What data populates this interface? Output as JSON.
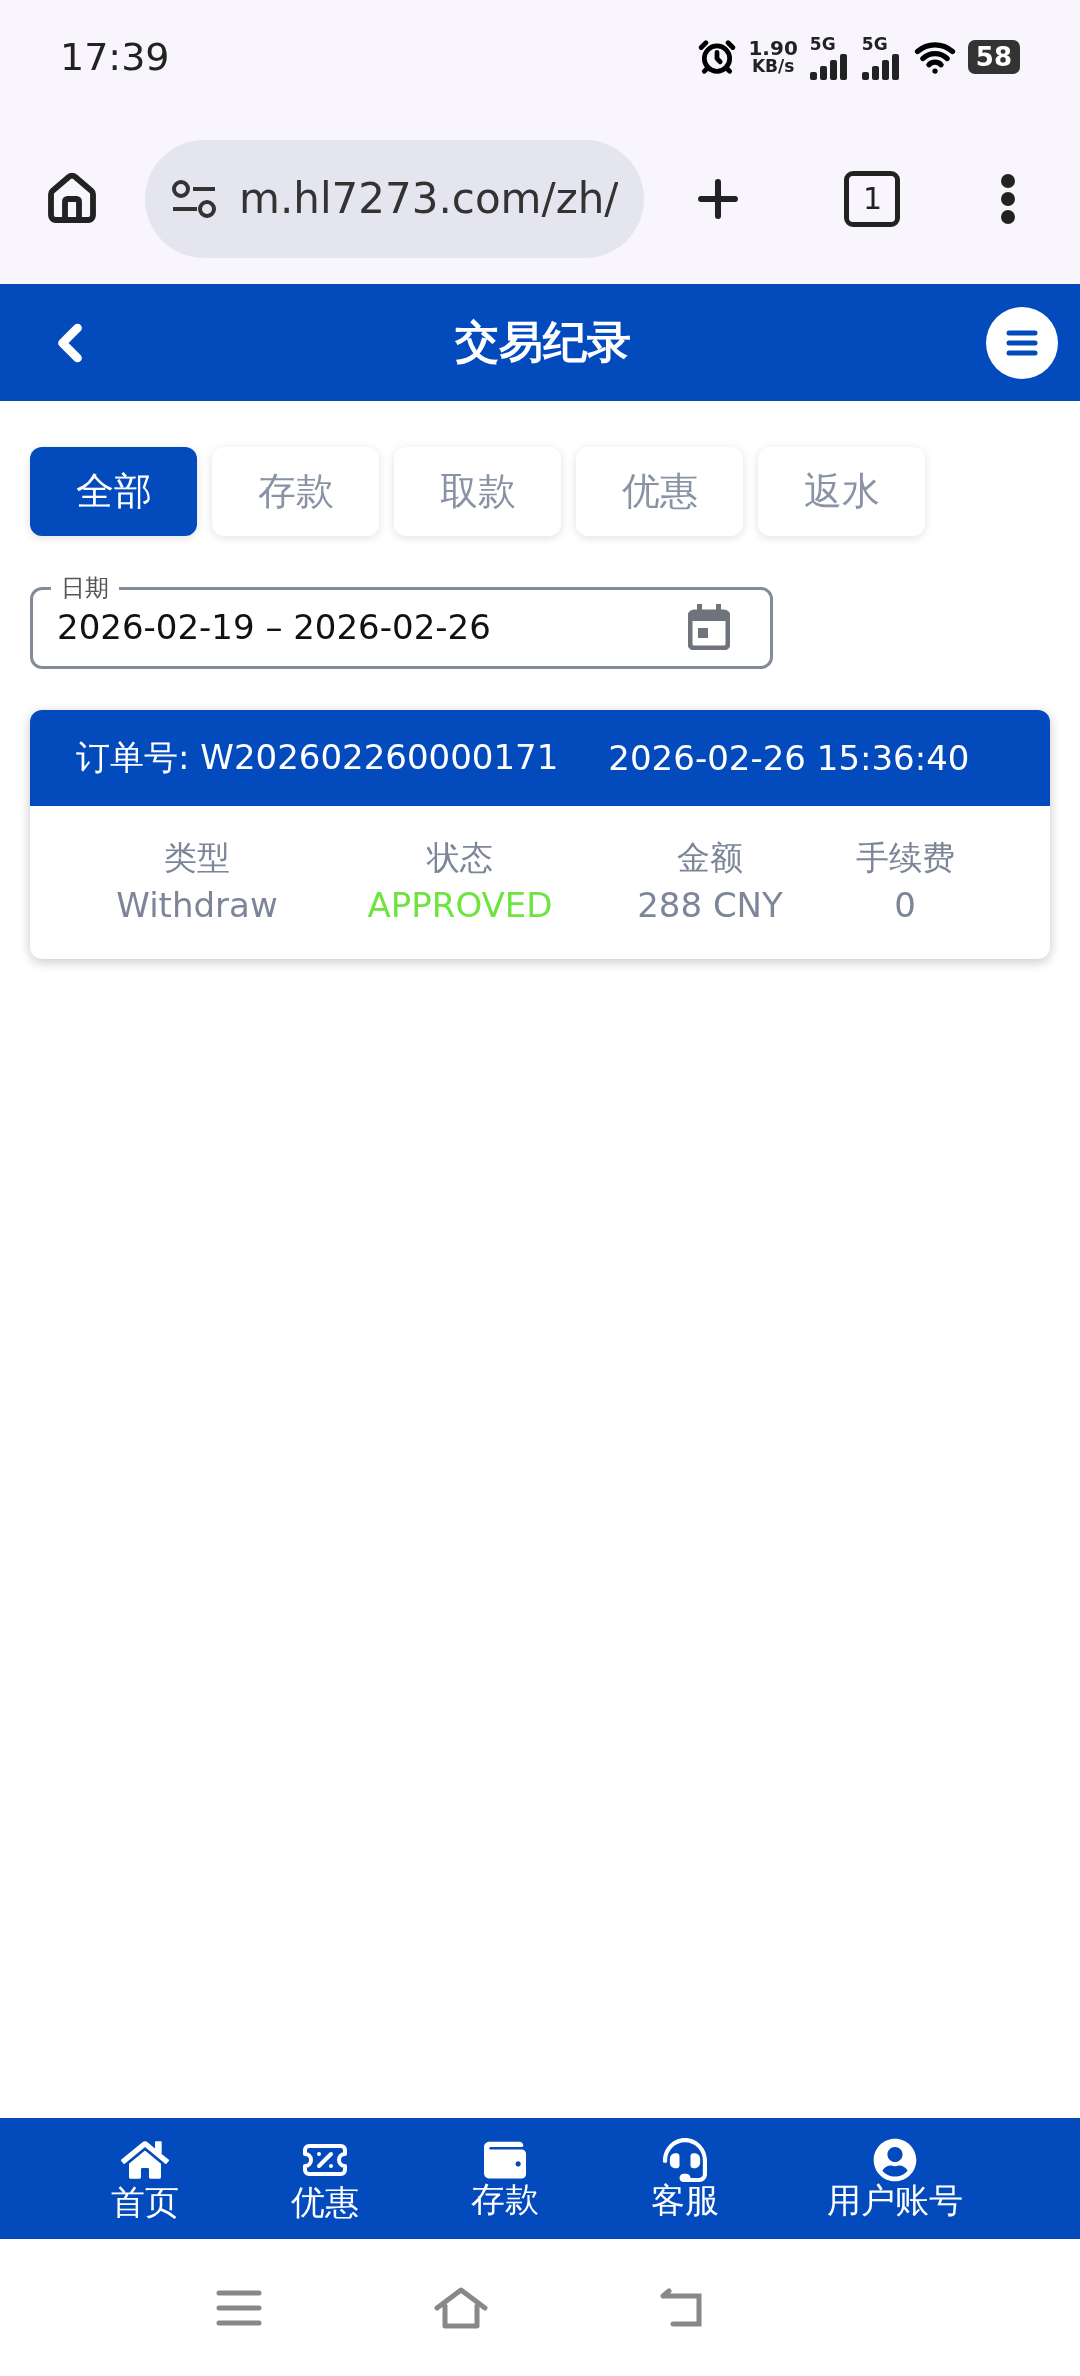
{
  "status_bar": {
    "time": "17:39",
    "net_speed": "1.90",
    "net_unit": "KB/s",
    "signals": [
      "5G",
      "5G"
    ],
    "battery": "58"
  },
  "browser": {
    "url": "m.hl7273.com/zh/",
    "tab_count": "1"
  },
  "header": {
    "title": "交易纪录"
  },
  "tabs": [
    {
      "label": "全部",
      "selected": true
    },
    {
      "label": "存款",
      "selected": false
    },
    {
      "label": "取款",
      "selected": false
    },
    {
      "label": "优惠",
      "selected": false
    },
    {
      "label": "返水",
      "selected": false
    }
  ],
  "date_field": {
    "label": "日期",
    "value": "2026-02-19 – 2026-02-26"
  },
  "transactions": [
    {
      "order_label": "订单号: W202602260000171",
      "time": "2026-02-26 15:36:40",
      "fields": [
        {
          "label": "类型",
          "value": "Withdraw",
          "kind": "plain"
        },
        {
          "label": "状态",
          "value": "APPROVED",
          "kind": "status"
        },
        {
          "label": "金额",
          "value": "288 CNY",
          "kind": "plain"
        },
        {
          "label": "手续费",
          "value": "0",
          "kind": "plain"
        }
      ]
    }
  ],
  "bottom_nav": [
    {
      "label": "首页",
      "kind": "home"
    },
    {
      "label": "优惠",
      "kind": "promo"
    },
    {
      "label": "存款",
      "kind": "wallet"
    },
    {
      "label": "客服",
      "kind": "support"
    },
    {
      "label": "用户账号",
      "kind": "account"
    }
  ]
}
